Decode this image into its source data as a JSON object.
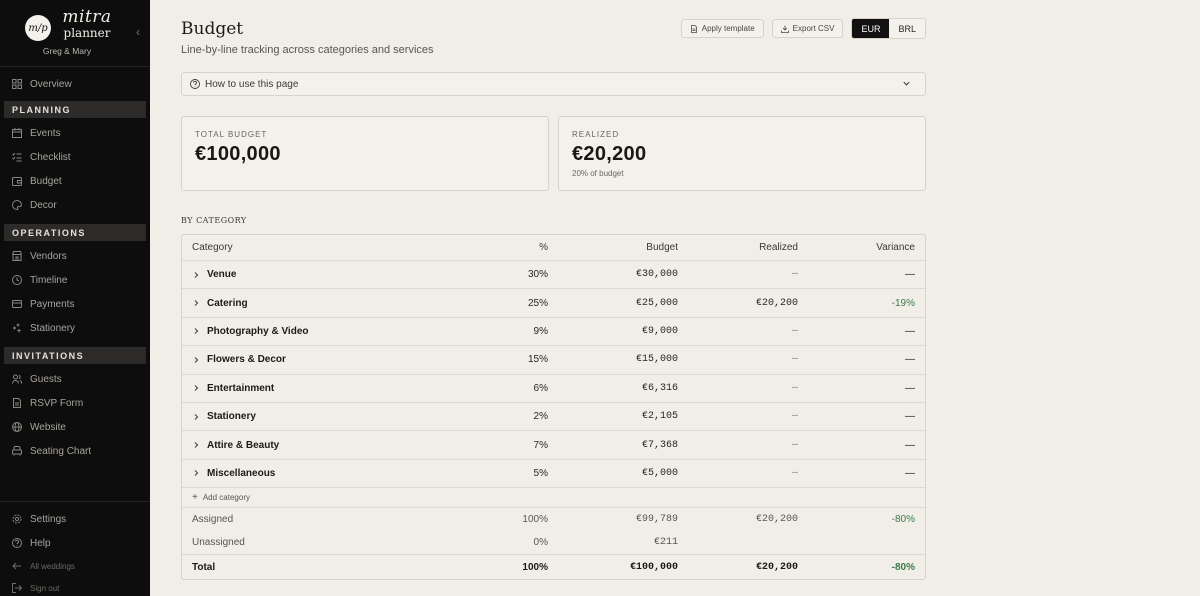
{
  "brand": {
    "logo_initials": "m/p",
    "word1": "mitra",
    "word2": "planner",
    "couple": "Greg & Mary"
  },
  "sidebar": {
    "overview": "Overview",
    "sections": [
      {
        "title": "PLANNING",
        "items": [
          "Events",
          "Checklist",
          "Budget",
          "Decor"
        ]
      },
      {
        "title": "OPERATIONS",
        "items": [
          "Vendors",
          "Timeline",
          "Payments",
          "Stationery"
        ]
      },
      {
        "title": "INVITATIONS",
        "items": [
          "Guests",
          "RSVP Form",
          "Website",
          "Seating Chart"
        ]
      }
    ],
    "bottom": {
      "settings": "Settings",
      "help": "Help",
      "all_weddings": "All weddings",
      "sign_out": "Sign out"
    }
  },
  "header": {
    "title": "Budget",
    "subtitle": "Line-by-line tracking across categories and services",
    "apply_template": "Apply template",
    "export_csv": "Export CSV",
    "currencies": [
      "EUR",
      "BRL"
    ],
    "active_currency": "EUR"
  },
  "accordion": {
    "label": "How to use this page"
  },
  "cards": {
    "total": {
      "label": "TOTAL BUDGET",
      "value": "€100,000"
    },
    "realized": {
      "label": "REALIZED",
      "value": "€20,200",
      "note": "20% of budget"
    }
  },
  "section_label": "BY CATEGORY",
  "table": {
    "headers": {
      "category": "Category",
      "pct": "%",
      "budget": "Budget",
      "realized": "Realized",
      "variance": "Variance"
    },
    "rows": [
      {
        "category": "Venue",
        "pct": "30%",
        "budget": "€30,000",
        "realized": "—",
        "variance": "—"
      },
      {
        "category": "Catering",
        "pct": "25%",
        "budget": "€25,000",
        "realized": "€20,200",
        "variance": "-19%"
      },
      {
        "category": "Photography & Video",
        "pct": "9%",
        "budget": "€9,000",
        "realized": "—",
        "variance": "—"
      },
      {
        "category": "Flowers & Decor",
        "pct": "15%",
        "budget": "€15,000",
        "realized": "—",
        "variance": "—"
      },
      {
        "category": "Entertainment",
        "pct": "6%",
        "budget": "€6,316",
        "realized": "—",
        "variance": "—"
      },
      {
        "category": "Stationery",
        "pct": "2%",
        "budget": "€2,105",
        "realized": "—",
        "variance": "—"
      },
      {
        "category": "Attire & Beauty",
        "pct": "7%",
        "budget": "€7,368",
        "realized": "—",
        "variance": "—"
      },
      {
        "category": "Miscellaneous",
        "pct": "5%",
        "budget": "€5,000",
        "realized": "—",
        "variance": "—"
      }
    ],
    "add_category": "Add category",
    "assigned": {
      "label": "Assigned",
      "pct": "100%",
      "budget": "€99,789",
      "realized": "€20,200",
      "variance": "-80%"
    },
    "unassigned": {
      "label": "Unassigned",
      "pct": "0%",
      "budget": "€211"
    },
    "total": {
      "label": "Total",
      "pct": "100%",
      "budget": "€100,000",
      "realized": "€20,200",
      "variance": "-80%"
    }
  },
  "colors": {
    "positive_variance": "#3b7a4a",
    "sidebar_bg": "#0d0d0d",
    "page_bg": "#f1ede7"
  }
}
